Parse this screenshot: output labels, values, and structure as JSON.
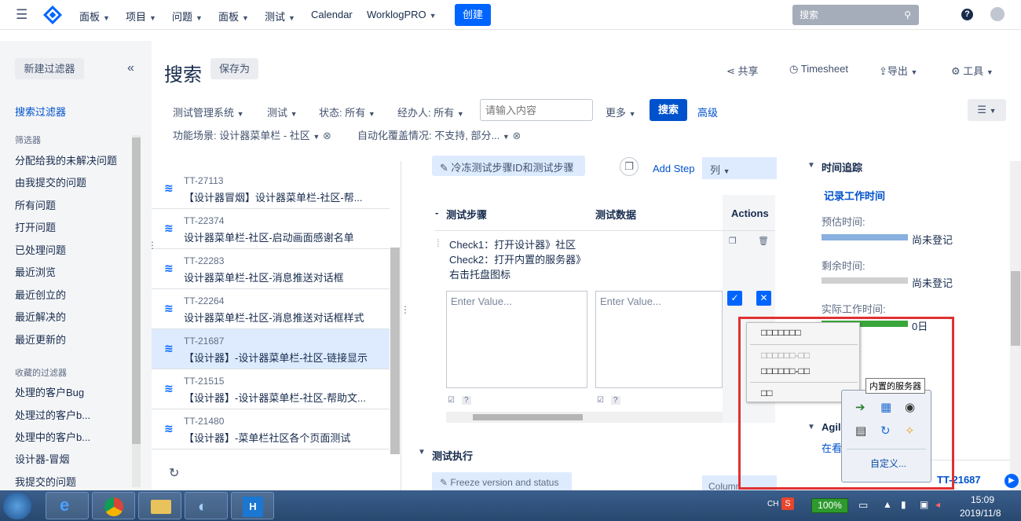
{
  "nav": {
    "menu": [
      "面板",
      "项目",
      "问题",
      "面板",
      "测试",
      "Calendar",
      "WorklogPRO"
    ],
    "create": "创建",
    "search_placeholder": "搜索"
  },
  "sidebar": {
    "new_filter": "新建过滤器",
    "collapse": "«",
    "search_filters": "搜索过滤器",
    "filters_head": "筛选器",
    "items": [
      "分配给我的未解决问题",
      "由我提交的问题",
      "所有问题",
      "打开问题",
      "已处理问题",
      "最近浏览",
      "最近创立的",
      "最近解决的",
      "最近更新的"
    ],
    "fav_head": "收藏的过滤器",
    "fav_items": [
      "处理的客户Bug",
      "处理过的客户b...",
      "处理中的客户b...",
      "设计器-冒烟",
      "我提交的问题"
    ]
  },
  "header": {
    "title": "搜索",
    "save_as": "保存为",
    "share": "共享",
    "timesheet": "Timesheet",
    "export": "导出",
    "tools": "工具"
  },
  "filters": {
    "row1": [
      "测试管理系统",
      "测试",
      "状态: 所有",
      "经办人: 所有"
    ],
    "input_placeholder": "请输入内容",
    "more": "更多",
    "search": "搜索",
    "advanced": "高级",
    "row2": [
      "功能场景: 设计器菜单栏 - 社区",
      "自动化覆盖情况: 不支持, 部分..."
    ]
  },
  "issues": [
    {
      "key": "TT-27113",
      "title": "【设计器冒烟】设计器菜单栏-社区-帮..."
    },
    {
      "key": "TT-22374",
      "title": "设计器菜单栏-社区-启动画面感谢名单"
    },
    {
      "key": "TT-22283",
      "title": "设计器菜单栏-社区-消息推送对话框"
    },
    {
      "key": "TT-22264",
      "title": "设计器菜单栏-社区-消息推送对话框样式"
    },
    {
      "key": "TT-21687",
      "title": "【设计器】-设计器菜单栏-社区-链接显示"
    },
    {
      "key": "TT-21515",
      "title": "【设计器】-设计器菜单栏-社区-帮助文..."
    },
    {
      "key": "TT-21480",
      "title": "【设计器】-菜单栏社区各个页面测试"
    }
  ],
  "detail": {
    "freeze": "冷冻测试步骤ID和测试步骤",
    "add_step": "Add Step",
    "col_btn": "列",
    "col_steps": "测试步骤",
    "col_data": "测试数据",
    "col_actions": "Actions",
    "step_lines": [
      "Check1：打开设计器》社区",
      "Check2：打开内置的服务器》",
      "右击托盘图标"
    ],
    "enter_value": "Enter Value...",
    "exec": "测试执行",
    "freeze2": "Freeze version and status",
    "columns": "Column"
  },
  "right": {
    "time_tracking": "时间追踪",
    "log_work": "记录工作时间",
    "estimated": "预估时间:",
    "not_logged": "尚未登记",
    "remaining": "剩余时间:",
    "actual": "实际工作时间:",
    "zero": "0日",
    "agile": "Agile",
    "link": "在看",
    "issue_link": "TT-21687"
  },
  "ctx": {
    "items": [
      "□□□□□□□",
      "□□□□□□-□□",
      "□□□□□□-□□",
      "□□"
    ],
    "tooltip": "内置的服务器",
    "customize": "自定义..."
  },
  "taskbar": {
    "lang": "CH",
    "battery": "100%",
    "time": "15:09",
    "date": "2019/11/8"
  }
}
